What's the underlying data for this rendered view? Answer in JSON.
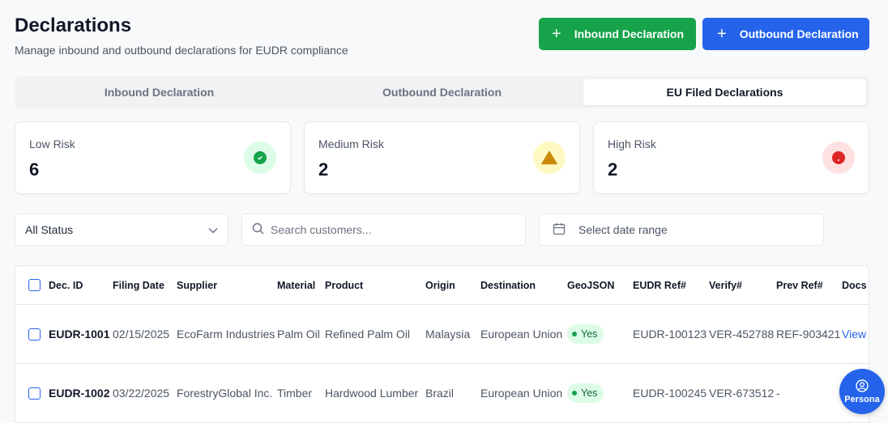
{
  "header": {
    "title": "Declarations",
    "subtitle": "Manage inbound and outbound declarations for EUDR compliance"
  },
  "actions": {
    "inbound_label": "Inbound Declaration",
    "outbound_label": "Outbound Declaration",
    "plus_glyph": "+",
    "inbound_color": "#16a34a",
    "outbound_color": "#2563eb"
  },
  "tabs": [
    {
      "label": "Inbound Declaration",
      "active": false
    },
    {
      "label": "Outbound Declaration",
      "active": false
    },
    {
      "label": "EU Filed Declarations",
      "active": true
    }
  ],
  "risk_cards": {
    "low": {
      "label": "Low Risk",
      "value": "6",
      "icon": "check-circle-icon",
      "color": "#16a34a",
      "bg": "#dcfce7"
    },
    "medium": {
      "label": "Medium Risk",
      "value": "2",
      "icon": "warning-triangle-icon",
      "color": "#ca8a04",
      "bg": "#fef9c3"
    },
    "high": {
      "label": "High Risk",
      "value": "2",
      "icon": "alert-circle-icon",
      "color": "#dc2626",
      "bg": "#fee2e2"
    }
  },
  "filters": {
    "status_value": "All Status",
    "search_placeholder": "Search customers...",
    "date_placeholder": "Select date range"
  },
  "table": {
    "columns": [
      "Dec. ID",
      "Filing Date",
      "Supplier",
      "Material",
      "Product",
      "Origin",
      "Destination",
      "GeoJSON",
      "EUDR Ref#",
      "Verify#",
      "Prev Ref#",
      "Docs"
    ],
    "rows": [
      {
        "id": "EUDR-1001",
        "filing_date": "02/15/2025",
        "supplier": "EcoFarm Industries",
        "material": "Palm Oil",
        "product": "Refined Palm Oil",
        "origin": "Malaysia",
        "destination": "European Union",
        "geojson": "Yes",
        "eudr_ref": "EUDR-100123",
        "verify": "VER-452788",
        "prev_ref": "REF-903421",
        "docs": "View"
      },
      {
        "id": "EUDR-1002",
        "filing_date": "03/22/2025",
        "supplier": "ForestryGlobal Inc.",
        "material": "Timber",
        "product": "Hardwood Lumber",
        "origin": "Brazil",
        "destination": "European Union",
        "geojson": "Yes",
        "eudr_ref": "EUDR-100245",
        "verify": "VER-673512",
        "prev_ref": "-",
        "docs": ""
      }
    ]
  },
  "persona": {
    "label": "Persona",
    "icon": "user-circle-icon"
  }
}
